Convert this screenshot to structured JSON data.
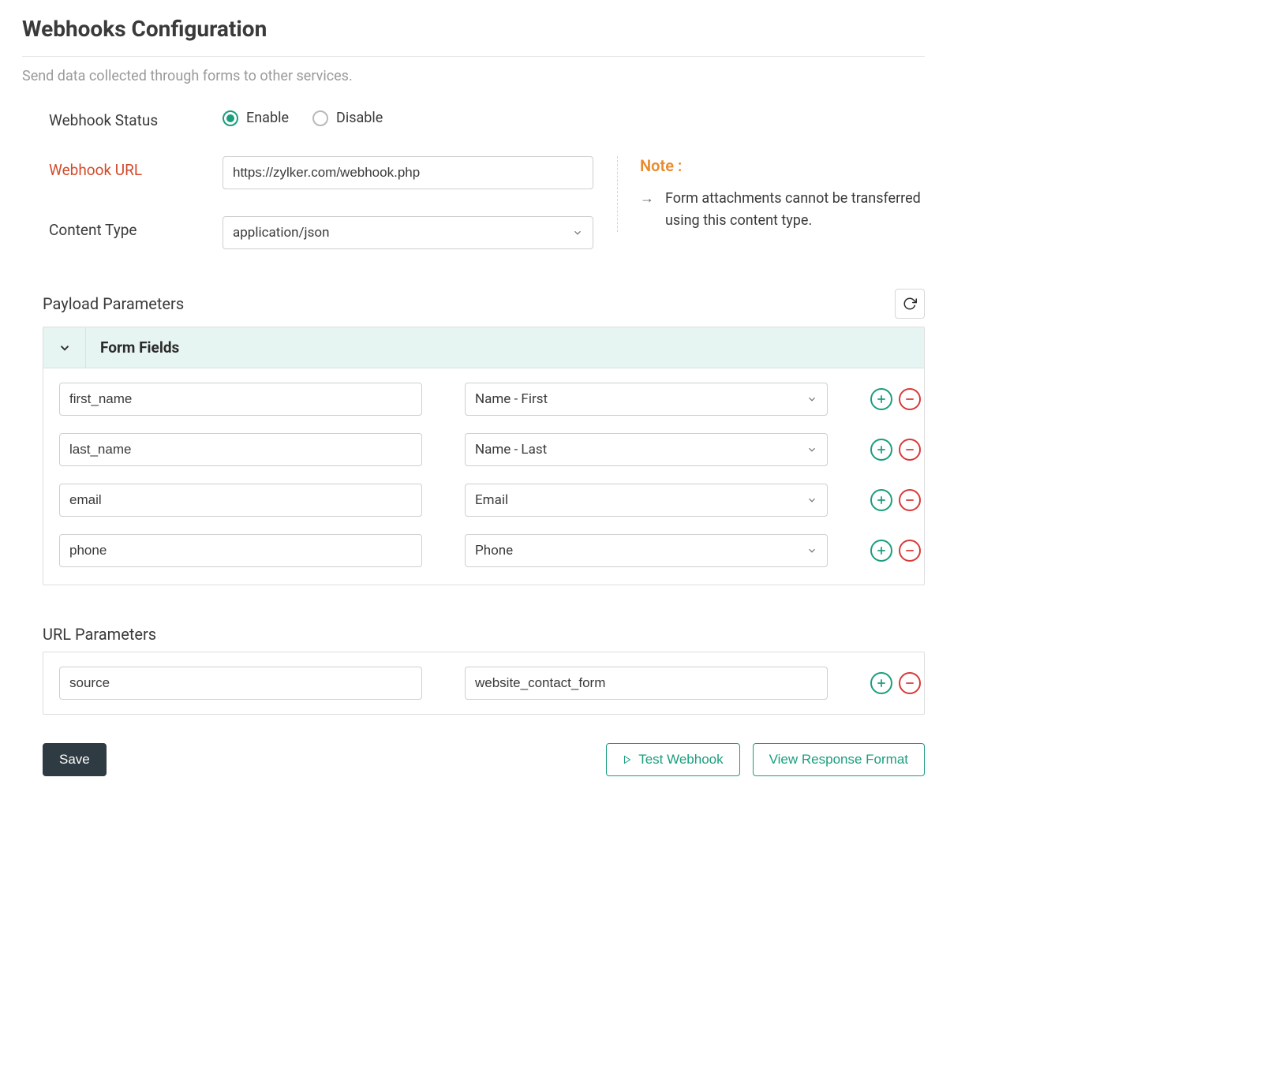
{
  "header": {
    "title": "Webhooks Configuration",
    "description": "Send data collected through forms to other services."
  },
  "fields": {
    "status": {
      "label": "Webhook Status",
      "enable_label": "Enable",
      "disable_label": "Disable",
      "value": "enable"
    },
    "url": {
      "label": "Webhook URL",
      "value": "https://zylker.com/webhook.php"
    },
    "content_type": {
      "label": "Content Type",
      "value": "application/json"
    }
  },
  "note": {
    "title": "Note :",
    "text": "Form attachments cannot be transferred using this content type."
  },
  "payload": {
    "section_label": "Payload Parameters",
    "form_fields_label": "Form Fields",
    "rows": [
      {
        "key": "first_name",
        "mapping": "Name - First"
      },
      {
        "key": "last_name",
        "mapping": "Name - Last"
      },
      {
        "key": "email",
        "mapping": "Email"
      },
      {
        "key": "phone",
        "mapping": "Phone"
      }
    ]
  },
  "url_params": {
    "section_label": "URL Parameters",
    "rows": [
      {
        "key": "source",
        "value": "website_contact_form"
      }
    ]
  },
  "footer": {
    "save_label": "Save",
    "test_label": "Test Webhook",
    "view_label": "View Response Format"
  }
}
